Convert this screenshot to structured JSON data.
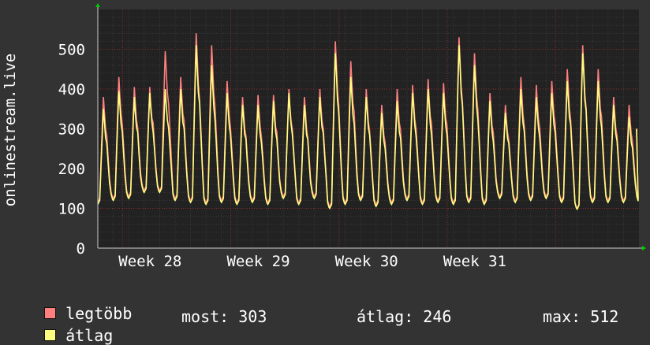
{
  "colors": {
    "background": "#333333",
    "plot_background": "#222222",
    "max_series": "#ff7f7f",
    "avg_series": "#ffff7f",
    "grid": "#666666",
    "week_grid": "#aa3333",
    "axis": "#cccccc",
    "arrow": "#00cc00"
  },
  "chart_data": {
    "type": "line",
    "ylabel": "onlinestream.live",
    "ylim": [
      0,
      600
    ],
    "y_ticks": [
      0,
      100,
      200,
      300,
      400,
      500
    ],
    "x_ticks": [
      "Week 28",
      "Week 29",
      "Week 30",
      "Week 31"
    ],
    "grid": true,
    "legend_placement": "bottom-left",
    "peak_days": 35,
    "series": [
      {
        "name": "legtöbb",
        "daily_peaks": [
          380,
          430,
          405,
          405,
          495,
          430,
          540,
          510,
          420,
          380,
          385,
          385,
          400,
          380,
          400,
          520,
          470,
          400,
          360,
          400,
          410,
          425,
          415,
          530,
          490,
          390,
          360,
          430,
          410,
          420,
          450,
          510,
          450,
          380,
          360
        ],
        "daily_lows": [
          115,
          125,
          130,
          145,
          145,
          125,
          120,
          115,
          120,
          115,
          120,
          115,
          130,
          115,
          130,
          105,
          115,
          125,
          110,
          115,
          125,
          115,
          120,
          115,
          120,
          115,
          130,
          120,
          125,
          130,
          120,
          100,
          120,
          120,
          120
        ]
      },
      {
        "name": "átlag",
        "daily_peaks": [
          350,
          395,
          380,
          390,
          400,
          400,
          510,
          460,
          390,
          360,
          360,
          370,
          390,
          360,
          380,
          490,
          430,
          380,
          340,
          370,
          390,
          400,
          390,
          510,
          460,
          370,
          340,
          400,
          380,
          390,
          420,
          490,
          420,
          360,
          330
        ],
        "daily_lows": [
          110,
          120,
          125,
          140,
          140,
          120,
          115,
          110,
          115,
          110,
          115,
          110,
          125,
          110,
          125,
          100,
          110,
          120,
          105,
          110,
          120,
          110,
          115,
          110,
          115,
          110,
          125,
          115,
          120,
          125,
          115,
          98,
          115,
          115,
          115
        ]
      }
    ]
  },
  "legend": [
    {
      "label": "legtöbb",
      "color": "#ff7f7f"
    },
    {
      "label": "átlag",
      "color": "#ffff7f"
    }
  ],
  "stats": {
    "now": "most: 303",
    "avg": "átlag: 246",
    "max": "max: 512"
  }
}
